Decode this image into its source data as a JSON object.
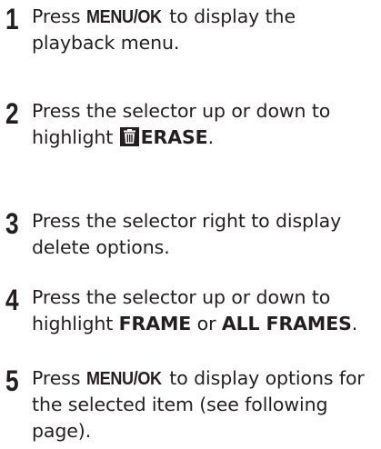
{
  "steps": [
    {
      "number": "1",
      "parts": [
        "Press ",
        "MENU/OK",
        " to display the playback menu."
      ]
    },
    {
      "number": "2",
      "parts": [
        "Press the selector up or down to highlight ",
        "ERASE",
        "."
      ],
      "icon": "trash-icon"
    },
    {
      "number": "3",
      "parts": [
        "Press the selector right to display delete options."
      ]
    },
    {
      "number": "4",
      "parts": [
        "Press the selector up or down to highlight ",
        "FRAME",
        " or ",
        "ALL FRAMES",
        "."
      ]
    },
    {
      "number": "5",
      "parts": [
        "Press ",
        "MENU/OK",
        " to display options for the selected item (see following page)."
      ]
    }
  ]
}
